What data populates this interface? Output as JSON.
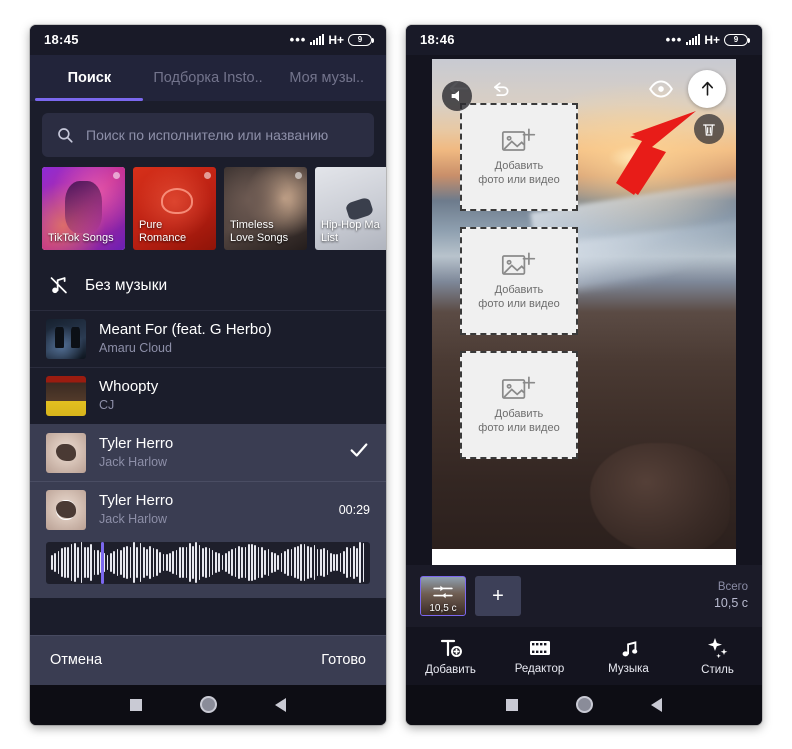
{
  "left_phone": {
    "status": {
      "time": "18:45",
      "network": "H+",
      "battery": "9"
    },
    "tabs": [
      {
        "label": "Поиск",
        "active": true
      },
      {
        "label": "Подборка Insto..",
        "active": false
      },
      {
        "label": "Моя музы..",
        "active": false
      }
    ],
    "search": {
      "placeholder": "Поиск по исполнителю или названию",
      "value": "",
      "icon": "search-icon"
    },
    "playlists": [
      {
        "label": "TikTok Songs",
        "selected": true,
        "art": "art-tiktok"
      },
      {
        "label": "Pure\nRomance",
        "selected": false,
        "art": "art-romance"
      },
      {
        "label": "Timeless\nLove Songs",
        "selected": false,
        "art": "art-love"
      },
      {
        "label": "Hip-Hop Ma\nList",
        "selected": false,
        "art": "art-hiphop"
      }
    ],
    "no_music": {
      "label": "Без музыки",
      "icon": "music-note-off-icon"
    },
    "tracks": [
      {
        "title": "Meant For (feat. G Herbo)",
        "artist": "Amaru Cloud",
        "duration": "",
        "state": "normal",
        "art": "thumb-meant"
      },
      {
        "title": "Whoopty",
        "artist": "CJ",
        "duration": "",
        "state": "normal",
        "art": "thumb-whoopty"
      },
      {
        "title": "Tyler Herro",
        "artist": "Jack Harlow",
        "duration": "",
        "state": "selected",
        "art": "thumb-tyler"
      },
      {
        "title": "Tyler Herro",
        "artist": "Jack Harlow",
        "duration": "00:29",
        "state": "playing",
        "art": "thumb-tyler"
      }
    ],
    "waveform": {
      "playhead_percent": 17
    },
    "actions": {
      "cancel": "Отмена",
      "done": "Готово"
    }
  },
  "right_phone": {
    "status": {
      "time": "18:46",
      "network": "H+",
      "battery": "9"
    },
    "toolbar": {
      "back_icon": "back-arrow-icon",
      "undo_icon": "undo-icon",
      "preview_icon": "eye-icon",
      "share_icon": "upload-icon"
    },
    "placeholders": [
      {
        "label": "Добавить\nфото или видео"
      },
      {
        "label": "Добавить\nфото или видео"
      },
      {
        "label": "Добавить\nфото или видео"
      }
    ],
    "overlay_buttons": {
      "mute_icon": "speaker-icon",
      "delete_icon": "trash-icon"
    },
    "annotation": {
      "type": "red-arrow",
      "points_to": "eye-icon",
      "color": "#e81c18"
    },
    "timeline": {
      "clip_duration": "10,5 с",
      "add_label": "+",
      "total_label": "Всего",
      "total_value": "10,5 с",
      "clip_border_color": "#7b68ee"
    },
    "bottom_nav": [
      {
        "label": "Добавить",
        "icon": "text-add-icon"
      },
      {
        "label": "Редактор",
        "icon": "film-strip-icon"
      },
      {
        "label": "Музыка",
        "icon": "music-note-icon"
      },
      {
        "label": "Стиль",
        "icon": "sparkle-icon"
      }
    ]
  },
  "theme": {
    "accent": "#7b68ee",
    "background": "#1b1d2b",
    "panel": "#22243a",
    "selected_row": "#3a3d52",
    "text_primary": "#ffffff",
    "text_secondary": "#8d8fa8",
    "annotation_red": "#e81c18"
  }
}
